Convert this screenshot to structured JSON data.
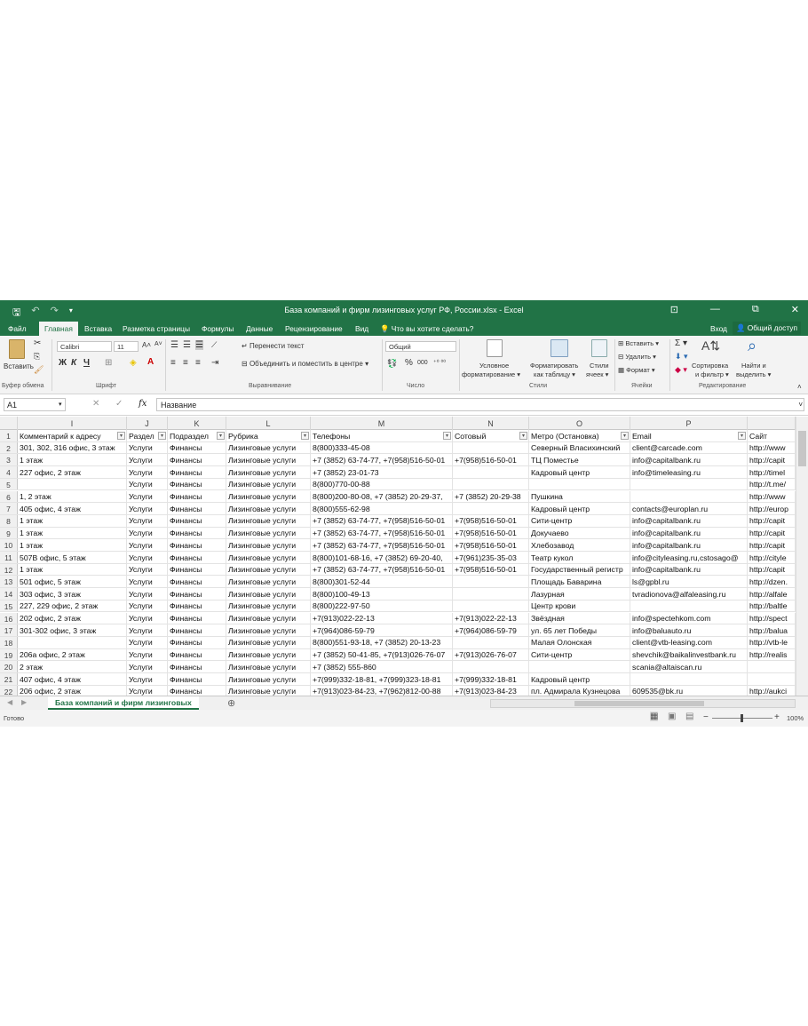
{
  "app": {
    "title": "База компаний и фирм лизинговых услуг РФ, России.xlsx - Excel"
  },
  "qat": {
    "save": "🖫",
    "undo": "↶",
    "redo": "↷",
    "more": "▾"
  },
  "window_buttons": {
    "ribbon_opts": "⊡",
    "minimize": "—",
    "restore": "⧉",
    "close": "✕"
  },
  "menu": {
    "tabs": [
      "Файл",
      "Главная",
      "Вставка",
      "Разметка страницы",
      "Формулы",
      "Данные",
      "Рецензирование",
      "Вид"
    ],
    "tell_me": "Что вы хотите сделать?",
    "signin": "Вход",
    "share": "Общий доступ"
  },
  "ribbon": {
    "clipboard": {
      "paste": "Вставить",
      "group": "Буфер обмена"
    },
    "font": {
      "name": "Calibri",
      "size": "11",
      "bold": "Ж",
      "italic": "К",
      "underline": "Ч",
      "grow": "A˄",
      "shrink": "A˅",
      "group": "Шрифт"
    },
    "alignment": {
      "wrap": "Перенести текст",
      "merge": "Объединить и поместить в центре",
      "group": "Выравнивание"
    },
    "number": {
      "format": "Общий",
      "percent": "%",
      "thousands": "000",
      "group": "Число"
    },
    "styles": {
      "conditional": [
        "Условное",
        "форматирование ▾"
      ],
      "table": [
        "Форматировать",
        "как таблицу ▾"
      ],
      "cell": [
        "Стили",
        "ячеек ▾"
      ],
      "group": "Стили"
    },
    "cells": {
      "insert": "Вставить ▾",
      "delete": "Удалить ▾",
      "format": "Формат ▾",
      "group": "Ячейки"
    },
    "editing": {
      "sort": [
        "Сортировка",
        "и фильтр ▾"
      ],
      "find": [
        "Найти и",
        "выделить ▾"
      ],
      "group": "Редактирование"
    }
  },
  "formula_bar": {
    "cell_ref": "A1",
    "fx": "fx",
    "cancel": "✕",
    "enter": "✓",
    "content": "Название"
  },
  "columns": [
    "I",
    "J",
    "K",
    "L",
    "M",
    "N",
    "O",
    "P",
    ""
  ],
  "header_row": [
    "Комментарий к адресу",
    "Раздел",
    "Подраздел",
    "Рубрика",
    "Телефоны",
    "Сотовый",
    "Метро (Остановка)",
    "Email",
    "Сайт"
  ],
  "rows": [
    {
      "n": "2",
      "cells": [
        "301, 302, 316 офис, 3 этаж",
        "Услуги",
        "Финансы",
        "Лизинговые услуги",
        "8(800)333-45-08",
        "",
        "Северный Власихинский",
        "client@carcade.com",
        "http://www"
      ]
    },
    {
      "n": "3",
      "cells": [
        "1 этаж",
        "Услуги",
        "Финансы",
        "Лизинговые услуги",
        "+7 (3852) 63-74-77, +7(958)516-50-01",
        "+7(958)516-50-01",
        "ТЦ Поместье",
        "info@capitalbank.ru",
        "http://capit"
      ]
    },
    {
      "n": "4",
      "cells": [
        "227 офис, 2 этаж",
        "Услуги",
        "Финансы",
        "Лизинговые услуги",
        "+7 (3852) 23-01-73",
        "",
        "Кадровый центр",
        "info@timeleasing.ru",
        "http://timel"
      ]
    },
    {
      "n": "5",
      "cells": [
        "",
        "Услуги",
        "Финансы",
        "Лизинговые услуги",
        "8(800)770-00-88",
        "",
        "",
        "",
        "http://t.me/"
      ]
    },
    {
      "n": "6",
      "cells": [
        "1, 2 этаж",
        "Услуги",
        "Финансы",
        "Лизинговые услуги",
        "8(800)200-80-08, +7 (3852) 20-29-37,",
        "+7 (3852) 20-29-38",
        "Пушкина",
        "",
        "http://www"
      ]
    },
    {
      "n": "7",
      "cells": [
        "405 офис, 4 этаж",
        "Услуги",
        "Финансы",
        "Лизинговые услуги",
        "8(800)555-62-98",
        "",
        "Кадровый центр",
        "contacts@europlan.ru",
        "http://europ"
      ]
    },
    {
      "n": "8",
      "cells": [
        "1 этаж",
        "Услуги",
        "Финансы",
        "Лизинговые услуги",
        "+7 (3852) 63-74-77, +7(958)516-50-01",
        "+7(958)516-50-01",
        "Сити-центр",
        "info@capitalbank.ru",
        "http://capit"
      ]
    },
    {
      "n": "9",
      "cells": [
        "1 этаж",
        "Услуги",
        "Финансы",
        "Лизинговые услуги",
        "+7 (3852) 63-74-77, +7(958)516-50-01",
        "+7(958)516-50-01",
        "Докучаево",
        "info@capitalbank.ru",
        "http://capit"
      ]
    },
    {
      "n": "10",
      "cells": [
        "1 этаж",
        "Услуги",
        "Финансы",
        "Лизинговые услуги",
        "+7 (3852) 63-74-77, +7(958)516-50-01",
        "+7(958)516-50-01",
        "Хлебозавод",
        "info@capitalbank.ru",
        "http://capit"
      ]
    },
    {
      "n": "11",
      "cells": [
        "507В офис, 5 этаж",
        "Услуги",
        "Финансы",
        "Лизинговые услуги",
        "8(800)101-68-16, +7 (3852) 69-20-40,",
        "+7(961)235-35-03",
        "Театр кукол",
        "info@cityleasing.ru,cstosago@",
        "http://cityle"
      ]
    },
    {
      "n": "12",
      "cells": [
        "1 этаж",
        "Услуги",
        "Финансы",
        "Лизинговые услуги",
        "+7 (3852) 63-74-77, +7(958)516-50-01",
        "+7(958)516-50-01",
        "Государственный регистр",
        "info@capitalbank.ru",
        "http://capit"
      ]
    },
    {
      "n": "13",
      "cells": [
        "501 офис, 5 этаж",
        "Услуги",
        "Финансы",
        "Лизинговые услуги",
        "8(800)301-52-44",
        "",
        "Площадь Баварина",
        "ls@gpbl.ru",
        "http://dzen."
      ]
    },
    {
      "n": "14",
      "cells": [
        "303 офис, 3 этаж",
        "Услуги",
        "Финансы",
        "Лизинговые услуги",
        "8(800)100-49-13",
        "",
        "Лазурная",
        "tvradionova@alfaleasing.ru",
        "http://alfale"
      ]
    },
    {
      "n": "15",
      "cells": [
        "227, 229 офис, 2 этаж",
        "Услуги",
        "Финансы",
        "Лизинговые услуги",
        "8(800)222-97-50",
        "",
        "Центр крови",
        "",
        "http://baltle"
      ]
    },
    {
      "n": "16",
      "cells": [
        "202 офис, 2 этаж",
        "Услуги",
        "Финансы",
        "Лизинговые услуги",
        "+7(913)022-22-13",
        "+7(913)022-22-13",
        "Звёздная",
        "info@spectehkom.com",
        "http://spect"
      ]
    },
    {
      "n": "17",
      "cells": [
        "301-302 офис, 3 этаж",
        "Услуги",
        "Финансы",
        "Лизинговые услуги",
        "+7(964)086-59-79",
        "+7(964)086-59-79",
        "ул. 65 лет Победы",
        "info@baluauto.ru",
        "http://balua"
      ]
    },
    {
      "n": "18",
      "cells": [
        "",
        "Услуги",
        "Финансы",
        "Лизинговые услуги",
        "8(800)551-93-18, +7 (3852) 20-13-23",
        "",
        "Малая Олонская",
        "client@vtb-leasing.com",
        "http://vtb-le"
      ]
    },
    {
      "n": "19",
      "cells": [
        "206а офис, 2 этаж",
        "Услуги",
        "Финансы",
        "Лизинговые услуги",
        "+7 (3852) 50-41-85, +7(913)026-76-07",
        "+7(913)026-76-07",
        "Сити-центр",
        "shevchik@baikalinvestbank.ru",
        "http://realis"
      ]
    },
    {
      "n": "20",
      "cells": [
        "2 этаж",
        "Услуги",
        "Финансы",
        "Лизинговые услуги",
        "+7 (3852) 555-860",
        "",
        "",
        "scania@altaiscan.ru",
        ""
      ]
    },
    {
      "n": "21",
      "cells": [
        "407 офис, 4 этаж",
        "Услуги",
        "Финансы",
        "Лизинговые услуги",
        "+7(999)332-18-81, +7(999)323-18-81",
        "+7(999)332-18-81",
        "Кадровый центр",
        "",
        ""
      ]
    },
    {
      "n": "22",
      "cells": [
        "206 офис, 2 этаж",
        "Услуги",
        "Финансы",
        "Лизинговые услуги",
        "+7(913)023-84-23, +7(962)812-00-88",
        "+7(913)023-84-23",
        "пл. Адмирала Кузнецова",
        "609535@bk.ru",
        "http://aukci"
      ]
    }
  ],
  "sheet": {
    "tab": "База компаний и фирм лизинговых",
    "add": "⊕"
  },
  "status": {
    "ready": "Готово",
    "zoom": "100%",
    "minus": "−",
    "plus": "+"
  },
  "colors": {
    "accent": "#217346"
  }
}
